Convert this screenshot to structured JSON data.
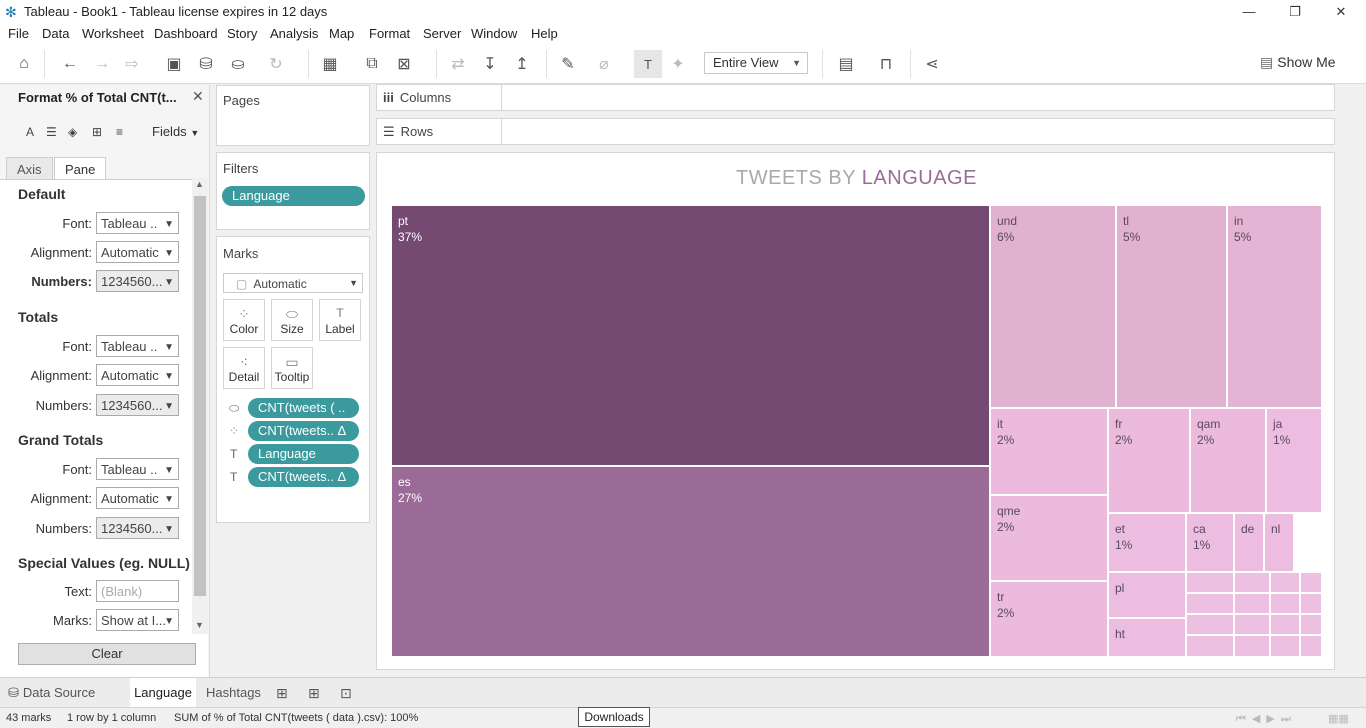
{
  "window": {
    "title": "Tableau - Book1 - Tableau license expires in 12 days",
    "minimize": "—",
    "restore": "❐",
    "close": "✕"
  },
  "menu": [
    "File",
    "Data",
    "Worksheet",
    "Dashboard",
    "Story",
    "Analysis",
    "Map",
    "Format",
    "Server",
    "Window",
    "Help"
  ],
  "toolbar": {
    "fit_value": "Entire View",
    "show_me_label": "Show Me"
  },
  "format_panel": {
    "title": "Format % of Total CNT(t...",
    "close": "✕",
    "fields_label": "Fields",
    "icon_font": "A",
    "tabs": {
      "axis": "Axis",
      "pane": "Pane"
    },
    "sections": {
      "default": {
        "heading": "Default",
        "font_label": "Font:",
        "font_value": "Tableau ..",
        "alignment_label": "Alignment:",
        "alignment_value": "Automatic",
        "numbers_label": "Numbers:",
        "numbers_value": "1234560..."
      },
      "totals": {
        "heading": "Totals",
        "font_label": "Font:",
        "font_value": "Tableau ..",
        "alignment_label": "Alignment:",
        "alignment_value": "Automatic",
        "numbers_label": "Numbers:",
        "numbers_value": "1234560..."
      },
      "grand_totals": {
        "heading": "Grand Totals",
        "font_label": "Font:",
        "font_value": "Tableau ..",
        "alignment_label": "Alignment:",
        "alignment_value": "Automatic",
        "numbers_label": "Numbers:",
        "numbers_value": "1234560..."
      },
      "special_values": {
        "heading": "Special Values (eg. NULL)",
        "text_label": "Text:",
        "text_placeholder": "(Blank)",
        "marks_label": "Marks:",
        "marks_value": "Show at I..."
      }
    },
    "clear_label": "Clear"
  },
  "pages": {
    "title": "Pages"
  },
  "filters": {
    "title": "Filters",
    "pills": [
      "Language"
    ]
  },
  "marks": {
    "title": "Marks",
    "mark_type": "Automatic",
    "buttons": {
      "color": "Color",
      "size": "Size",
      "label": "Label",
      "detail": "Detail",
      "tooltip": "Tooltip"
    },
    "fields": [
      {
        "icon": "size-icon",
        "glyph": "⬭",
        "label": "CNT(tweets ( .."
      },
      {
        "icon": "color-icon",
        "glyph": "⁘",
        "label": "CNT(tweets.. Δ"
      },
      {
        "icon": "label-icon",
        "glyph": "T",
        "label": "Language"
      },
      {
        "icon": "label-icon",
        "glyph": "T",
        "label": "CNT(tweets.. Δ"
      }
    ]
  },
  "shelves": {
    "columns": "Columns",
    "rows": "Rows"
  },
  "view": {
    "title_part1": "TWEETS BY ",
    "title_part2": "LANGUAGE"
  },
  "chart_data": {
    "type": "treemap",
    "title": "TWEETS BY LANGUAGE",
    "measure": "% of Total CNT(tweets)",
    "items": [
      {
        "label": "pt",
        "value_label": "37%",
        "color": "#744a73"
      },
      {
        "label": "es",
        "value_label": "27%",
        "color": "#9b6b98"
      },
      {
        "label": "und",
        "value_label": "6%",
        "color": "#e1b1d0"
      },
      {
        "label": "tl",
        "value_label": "5%",
        "color": "#e1b1d0"
      },
      {
        "label": "in",
        "value_label": "5%",
        "color": "#e3b4d3"
      },
      {
        "label": "it",
        "value_label": "2%",
        "color": "#ebbadc"
      },
      {
        "label": "fr",
        "value_label": "2%",
        "color": "#ebbadc"
      },
      {
        "label": "qam",
        "value_label": "2%",
        "color": "#ebbadc"
      },
      {
        "label": "ja",
        "value_label": "1%",
        "color": "#ecbde0"
      },
      {
        "label": "qme",
        "value_label": "2%",
        "color": "#ebbadc"
      },
      {
        "label": "tr",
        "value_label": "2%",
        "color": "#ebbadc"
      },
      {
        "label": "et",
        "value_label": "1%",
        "color": "#ecbde0"
      },
      {
        "label": "ca",
        "value_label": "1%",
        "color": "#ecbde0"
      },
      {
        "label": "de",
        "value_label": "",
        "color": "#ecbde0"
      },
      {
        "label": "nl",
        "value_label": "",
        "color": "#ecbde0"
      },
      {
        "label": "pl",
        "value_label": "",
        "color": "#ecbde0"
      },
      {
        "label": "ht",
        "value_label": "",
        "color": "#ecbde0"
      }
    ]
  },
  "sheet_tabs": {
    "data_source": "Data Source",
    "active": "Language",
    "other": "Hashtags"
  },
  "status": {
    "marks": "43 marks",
    "dims": "1 row by 1 column",
    "sum": "SUM of % of Total CNT(tweets ( data ).csv): 100%",
    "downloads": "Downloads"
  }
}
